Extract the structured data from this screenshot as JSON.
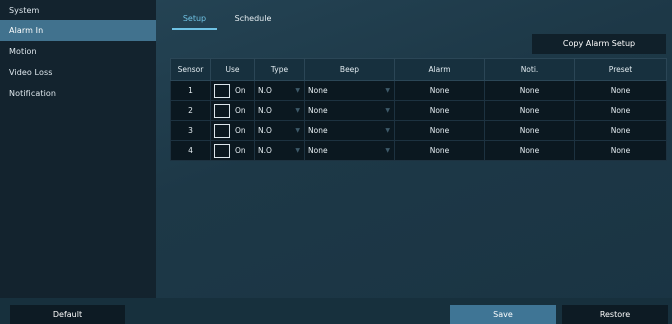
{
  "sidebar": {
    "items": [
      {
        "label": "System"
      },
      {
        "label": "Alarm In"
      },
      {
        "label": "Motion"
      },
      {
        "label": "Video Loss"
      },
      {
        "label": "Notification"
      }
    ],
    "active_index": 1
  },
  "tabs": [
    {
      "label": "Setup",
      "active": true
    },
    {
      "label": "Schedule",
      "active": false
    }
  ],
  "copy_button": "Copy Alarm Setup",
  "table": {
    "headers": [
      "Sensor",
      "Use",
      "Type",
      "Beep",
      "Alarm",
      "Noti.",
      "Preset"
    ],
    "rows": [
      {
        "sensor": "1",
        "use": "On",
        "type": "N.O",
        "beep": "None",
        "alarm": "None",
        "noti": "None",
        "preset": "None"
      },
      {
        "sensor": "2",
        "use": "On",
        "type": "N.O",
        "beep": "None",
        "alarm": "None",
        "noti": "None",
        "preset": "None"
      },
      {
        "sensor": "3",
        "use": "On",
        "type": "N.O",
        "beep": "None",
        "alarm": "None",
        "noti": "None",
        "preset": "None"
      },
      {
        "sensor": "4",
        "use": "On",
        "type": "N.O",
        "beep": "None",
        "alarm": "None",
        "noti": "None",
        "preset": "None"
      }
    ]
  },
  "buttons": {
    "default": "Default",
    "save": "Save",
    "restore": "Restore"
  },
  "icons": {
    "dropdown": "chevron-down-icon"
  },
  "colors": {
    "accent": "#6fc2e4",
    "active_bg": "#41728e",
    "save_bg": "#3f7595",
    "value_text": "#76b7dd"
  }
}
